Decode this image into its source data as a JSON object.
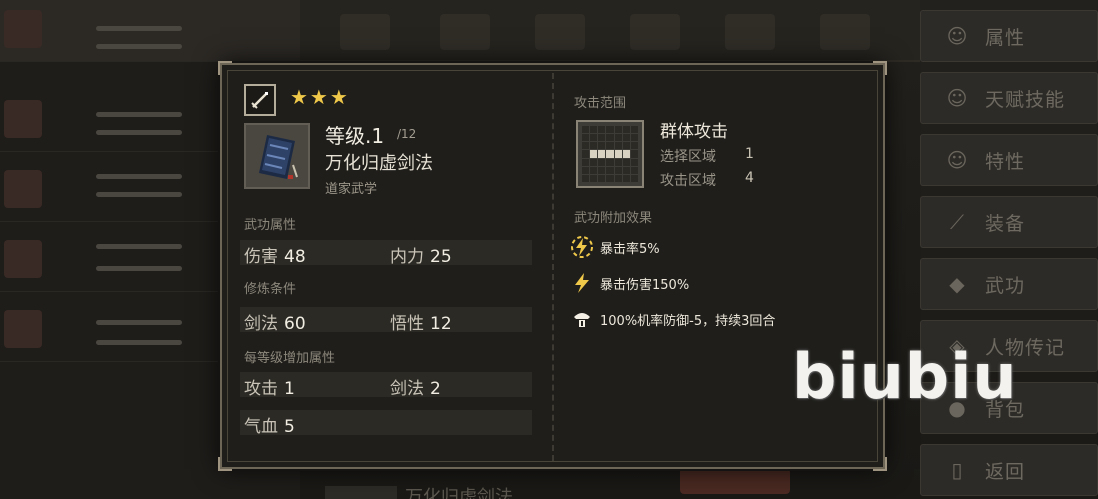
{
  "menu": {
    "items": [
      {
        "label": "属性",
        "icon": "character-icon"
      },
      {
        "label": "天赋技能",
        "icon": "talent-icon"
      },
      {
        "label": "特性",
        "icon": "trait-icon"
      },
      {
        "label": "装备",
        "icon": "equipment-icon"
      },
      {
        "label": "武功",
        "icon": "martial-art-icon"
      },
      {
        "label": "人物传记",
        "icon": "biography-icon"
      },
      {
        "label": "背包",
        "icon": "backpack-icon"
      },
      {
        "label": "返回",
        "icon": "return-icon"
      }
    ]
  },
  "background": {
    "bottom_text": "万化归虚剑法"
  },
  "skill": {
    "type_icon": "sword-icon",
    "stars": "★★★",
    "icon": "book-icon",
    "level_label": "等级.1",
    "level_max": "/12",
    "name": "万化归虚剑法",
    "school": "道家武学"
  },
  "attributes": {
    "title": "武功属性",
    "items": [
      {
        "label": "伤害",
        "value": "48"
      },
      {
        "label": "内力",
        "value": "25"
      }
    ]
  },
  "requirements": {
    "title": "修炼条件",
    "items": [
      {
        "label": "剑法",
        "value": "60"
      },
      {
        "label": "悟性",
        "value": "12"
      }
    ]
  },
  "per_level": {
    "title": "每等级增加属性",
    "rows": [
      [
        {
          "label": "攻击",
          "value": "1"
        },
        {
          "label": "剑法",
          "value": "2"
        }
      ],
      [
        {
          "label": "气血",
          "value": "5"
        }
      ]
    ]
  },
  "attack_range": {
    "title": "攻击范围",
    "name": "群体攻击",
    "select_label": "选择区域",
    "select_value": "1",
    "attack_label": "攻击区域",
    "attack_value": "4"
  },
  "effects": {
    "title": "武功附加效果",
    "items": [
      {
        "icon": "lightning-circle-icon",
        "text": "暴击率5%"
      },
      {
        "icon": "lightning-icon",
        "text": "暴击伤害150%"
      },
      {
        "icon": "shield-break-icon",
        "text": "100%机率防御-5，持续3回合"
      }
    ]
  },
  "colors": {
    "accent_gold": "#f0c94a",
    "panel_bg": "#1f1e1b",
    "border": "#6d6657"
  },
  "watermark": "biubiu"
}
